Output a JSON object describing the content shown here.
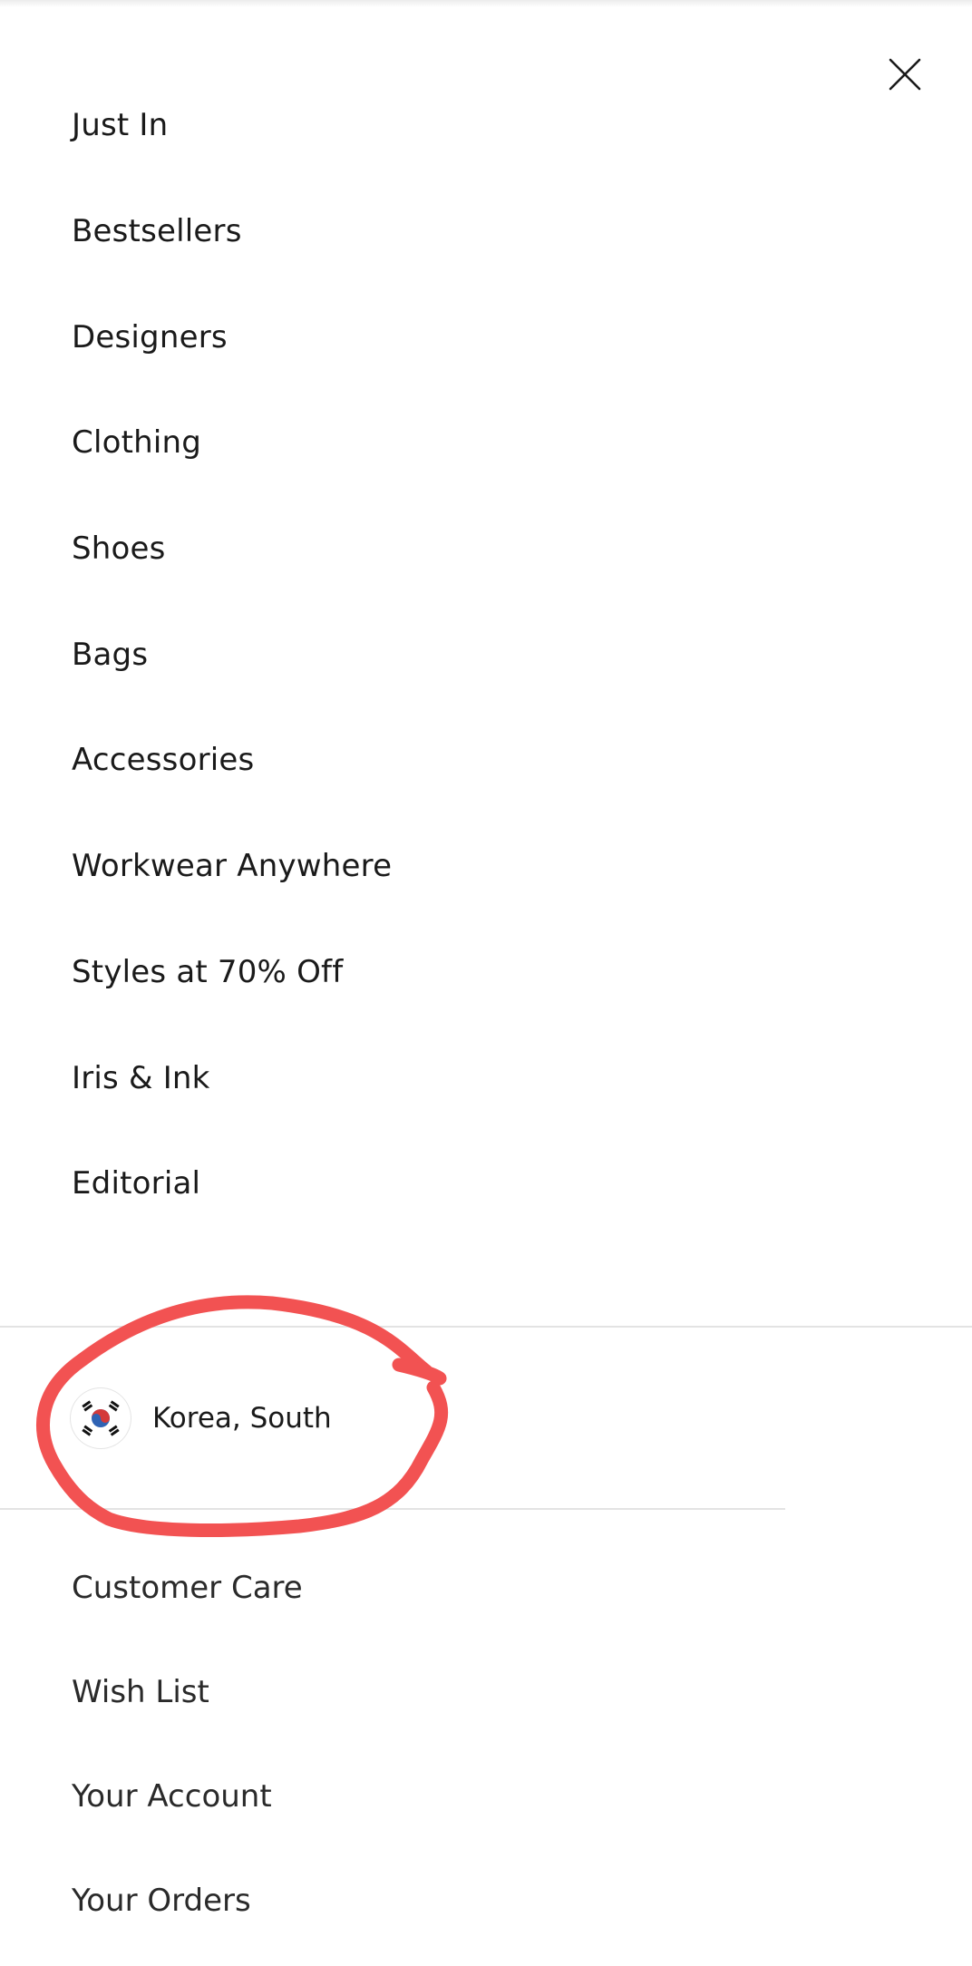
{
  "nav": {
    "items": [
      {
        "label": "Just In"
      },
      {
        "label": "Bestsellers"
      },
      {
        "label": "Designers"
      },
      {
        "label": "Clothing"
      },
      {
        "label": "Shoes"
      },
      {
        "label": "Bags"
      },
      {
        "label": "Accessories"
      },
      {
        "label": "Workwear Anywhere"
      },
      {
        "label": "Styles at 70% Off"
      },
      {
        "label": "Iris & Ink"
      },
      {
        "label": "Editorial"
      }
    ]
  },
  "country": {
    "name": "Korea, South",
    "flag_icon": "korea-flag-icon"
  },
  "footer": {
    "items": [
      {
        "label": "Customer Care"
      },
      {
        "label": "Wish List"
      },
      {
        "label": "Your Account"
      },
      {
        "label": "Your Orders"
      }
    ]
  },
  "icons": {
    "close": "close-icon"
  },
  "colors": {
    "annotation": "#f25252",
    "text": "#1a1a1a",
    "divider": "#e3e3e3"
  }
}
